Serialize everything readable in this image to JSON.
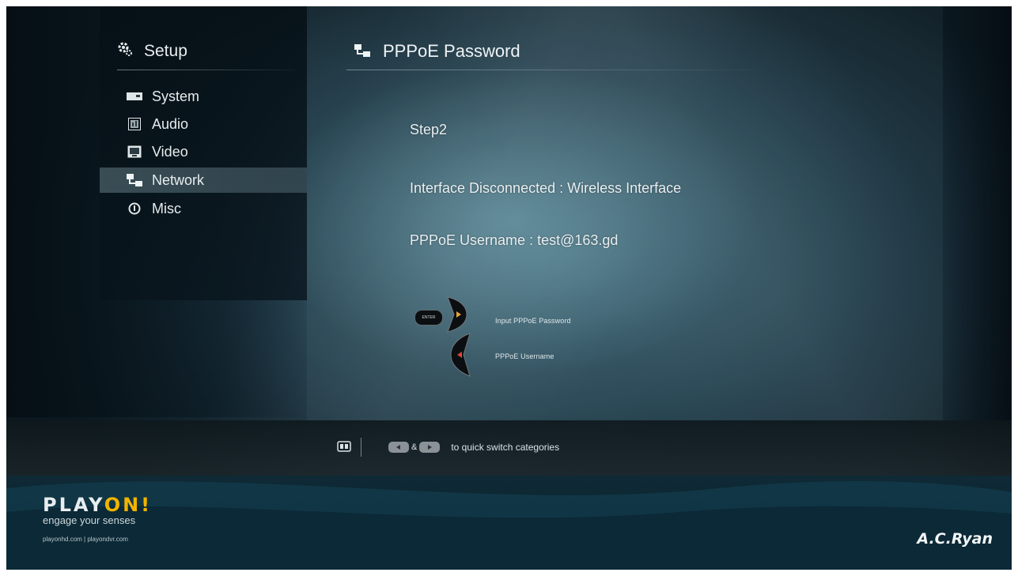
{
  "sidebar": {
    "title": "Setup",
    "title_icon": "gear-icon",
    "items": [
      {
        "label": "System",
        "icon": "system-icon"
      },
      {
        "label": "Audio",
        "icon": "audio-icon"
      },
      {
        "label": "Video",
        "icon": "video-icon"
      },
      {
        "label": "Network",
        "icon": "network-icon",
        "selected": true
      },
      {
        "label": "Misc",
        "icon": "info-icon"
      }
    ]
  },
  "main": {
    "title": "PPPoE Password",
    "title_icon": "network-icon",
    "step": "Step2",
    "interface_line": "Interface Disconnected : Wireless Interface",
    "username_line": "PPPoE Username : test@163.gd",
    "remote_hints": {
      "enter_label": "ENTER",
      "right": "Input PPPoE Password",
      "left": "PPPoE Username"
    }
  },
  "footer": {
    "hint_icon": "remote-icon",
    "and_label": "&",
    "switch_text": "to quick switch categories"
  },
  "brand": {
    "logo_part1": "PLAY",
    "logo_part2": "ON!",
    "tagline": "engage your senses",
    "urls": "playonhd.com | playondvr.com",
    "maker": "A.C.Ryan"
  },
  "colors": {
    "selected_row": "#8fb2bc",
    "logo_accent": "#f2b400",
    "text": "#e9f0f2"
  }
}
